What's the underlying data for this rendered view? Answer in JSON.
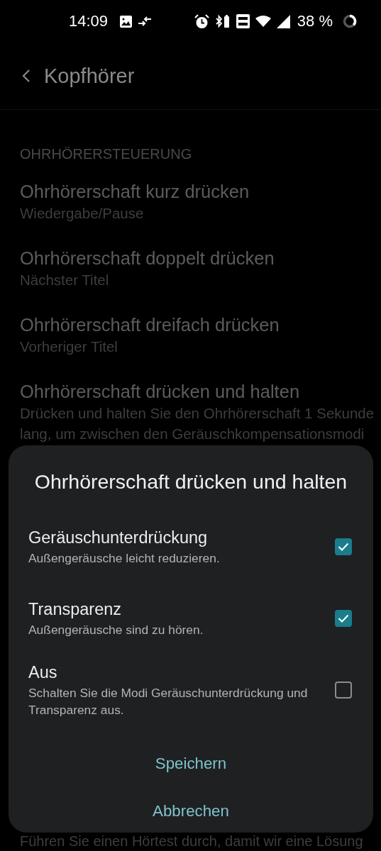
{
  "status_bar": {
    "time": "14:09",
    "battery": "38 %"
  },
  "header": {
    "title": "Kopfhörer"
  },
  "section": {
    "header": "OHRHÖRERSTEUERUNG",
    "items": [
      {
        "title": "Ohrhörerschaft kurz drücken",
        "summary": "Wiedergabe/Pause"
      },
      {
        "title": "Ohrhörerschaft doppelt drücken",
        "summary": "Nächster Titel"
      },
      {
        "title": "Ohrhörerschaft dreifach drücken",
        "summary": "Vorheriger Titel"
      },
      {
        "title": "Ohrhörerschaft drücken und halten",
        "summary": "Drücken und halten Sie den Ohrhörerschaft 1 Sekunde lang, um zwischen den Geräuschkompensationsmodi"
      }
    ]
  },
  "footer_text": "Führen Sie einen Hörtest durch, damit wir eine Lösung",
  "dialog": {
    "title": "Ohrhörerschaft drücken und halten",
    "options": [
      {
        "title": "Geräuschunterdrückung",
        "summary": "Außengeräusche leicht reduzieren.",
        "checked": true
      },
      {
        "title": "Transparenz",
        "summary": "Außengeräusche sind zu hören.",
        "checked": true
      },
      {
        "title": "Aus",
        "summary": "Schalten Sie die Modi Geräuschunterdrückung und Transparenz aus.",
        "checked": false
      }
    ],
    "buttons": [
      "Speichern",
      "Abbrechen"
    ]
  }
}
